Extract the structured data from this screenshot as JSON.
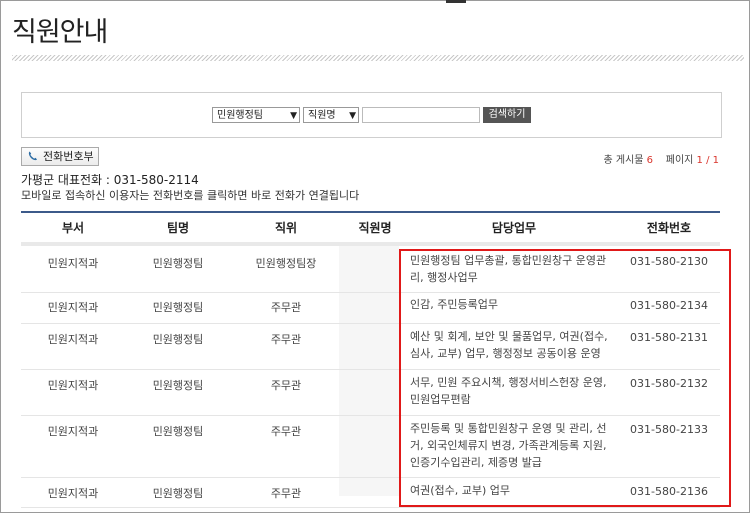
{
  "page_title": "직원안내",
  "search": {
    "team_select": "민원행정팀",
    "field_select": "직원명",
    "input_value": "",
    "button_label": "검색하기"
  },
  "phone_book_button": "전화번호부",
  "counts": {
    "total_label": "총 게시물",
    "total_value": "6",
    "page_label": "페이지",
    "page_value": "1 / 1"
  },
  "representative": "가평군 대표전화 : 031-580-2114",
  "mobile_notice": "모바일로 접속하신 이용자는 전화번호를 클릭하면 바로 전화가 연결됩니다",
  "table": {
    "headers": [
      "부서",
      "팀명",
      "직위",
      "직원명",
      "담당업무",
      "전화번호"
    ],
    "rows": [
      {
        "dept": "민원지적과",
        "team": "민원행정팀",
        "position": "민원행정팀장",
        "name": "",
        "task_lines": [
          "민원행정팀 업무총괄, 통합민원창구 운영관",
          "리, 행정사업무"
        ],
        "phone": "031-580-2130"
      },
      {
        "dept": "민원지적과",
        "team": "민원행정팀",
        "position": "주무관",
        "name": "",
        "task_lines": [
          "인감, 주민등록업무"
        ],
        "phone": "031-580-2134"
      },
      {
        "dept": "민원지적과",
        "team": "민원행정팀",
        "position": "주무관",
        "name": "",
        "task_lines": [
          "예산 및 회계, 보안 및 물품업무, 여권(접수,",
          "심사, 교부) 업무, 행정정보 공동이용 운영"
        ],
        "phone": "031-580-2131"
      },
      {
        "dept": "민원지적과",
        "team": "민원행정팀",
        "position": "주무관",
        "name": "",
        "task_lines": [
          "서무, 민원 주요시책, 행정서비스헌장 운영,",
          "민원업무편람"
        ],
        "phone": "031-580-2132"
      },
      {
        "dept": "민원지적과",
        "team": "민원행정팀",
        "position": "주무관",
        "name": "",
        "task_lines": [
          "주민등록 및 통합민원창구 운영 및 관리, 선",
          "거, 외국인체류지 변경, 가족관계등록 지원,",
          "인증기수입관리, 제증명 발급"
        ],
        "phone": "031-580-2133"
      },
      {
        "dept": "민원지적과",
        "team": "민원행정팀",
        "position": "주무관",
        "name": "",
        "task_lines": [
          "여권(접수, 교부) 업무"
        ],
        "phone": "031-580-2136"
      }
    ]
  },
  "colors": {
    "accent_red": "#e01919",
    "header_rule": "#3c5a8a",
    "count_red": "#d9342b"
  }
}
